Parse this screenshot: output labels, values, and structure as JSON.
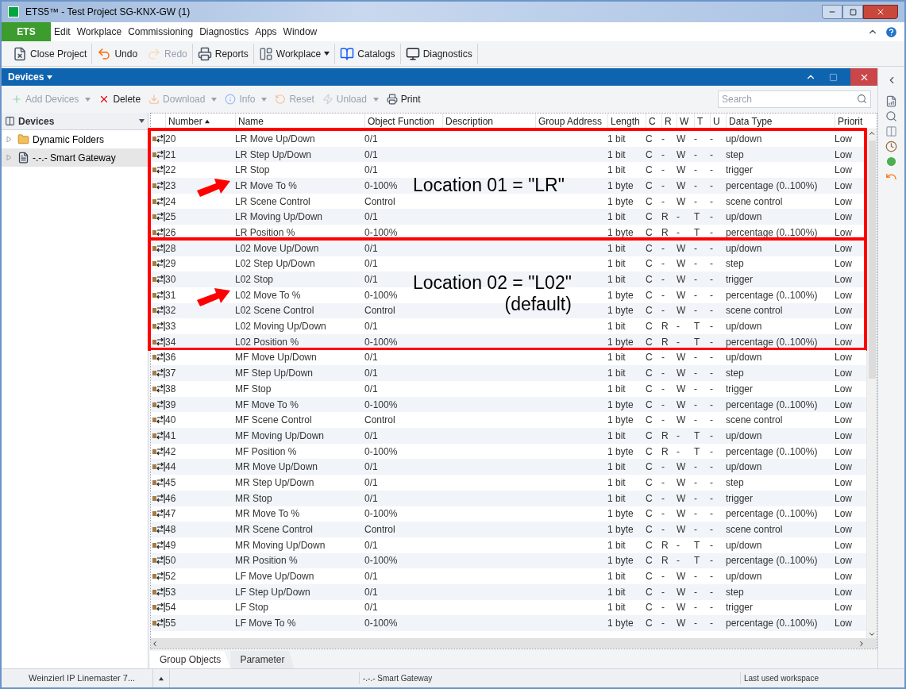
{
  "window": {
    "title": "ETS5™ - Test Project SG-KNX-GW (1)"
  },
  "menu": {
    "app_tab": "ETS",
    "items": [
      "Edit",
      "Workplace",
      "Commissioning",
      "Diagnostics",
      "Apps",
      "Window"
    ]
  },
  "toolbar": [
    {
      "label": "Close Project",
      "kind": "close",
      "disabled": false,
      "dropdown": false
    },
    {
      "label": "Undo",
      "kind": "undo",
      "disabled": false,
      "dropdown": false
    },
    {
      "label": "Redo",
      "kind": "redo",
      "disabled": true,
      "dropdown": false
    },
    {
      "label": "Reports",
      "kind": "print",
      "disabled": false,
      "dropdown": false
    },
    {
      "label": "Workplace",
      "kind": "layout",
      "disabled": false,
      "dropdown": true
    },
    {
      "label": "Catalogs",
      "kind": "book",
      "disabled": false,
      "dropdown": false
    },
    {
      "label": "Diagnostics",
      "kind": "monitor",
      "disabled": false,
      "dropdown": false
    }
  ],
  "panel": {
    "title": "Devices",
    "actions": [
      {
        "label": "Add Devices",
        "kind": "add",
        "disabled": true,
        "dropdown": true
      },
      {
        "label": "Delete",
        "kind": "delete",
        "disabled": false,
        "dropdown": false
      },
      {
        "label": "Download",
        "kind": "download",
        "disabled": true,
        "dropdown": true
      },
      {
        "label": "Info",
        "kind": "info",
        "disabled": true,
        "dropdown": true
      },
      {
        "label": "Reset",
        "kind": "reset",
        "disabled": true,
        "dropdown": false
      },
      {
        "label": "Unload",
        "kind": "unload",
        "disabled": true,
        "dropdown": true
      },
      {
        "label": "Print",
        "kind": "print",
        "disabled": false,
        "dropdown": false
      }
    ],
    "search": {
      "placeholder": "Search"
    }
  },
  "sidebar": {
    "title": "Devices",
    "items": [
      {
        "label": "Dynamic Folders",
        "kind": "folder",
        "expanded": false,
        "selected": false
      },
      {
        "label": "-.-.- Smart Gateway",
        "kind": "device",
        "expanded": false,
        "selected": true
      }
    ]
  },
  "table": {
    "columns": [
      {
        "label": "Number",
        "sorted": true
      },
      {
        "label": "Name",
        "sorted": false
      },
      {
        "label": "Object Function",
        "sorted": false
      },
      {
        "label": "Description",
        "sorted": false
      },
      {
        "label": "Group Address",
        "sorted": false
      },
      {
        "label": "Length",
        "sorted": false
      },
      {
        "label": "C",
        "sorted": false
      },
      {
        "label": "R",
        "sorted": false
      },
      {
        "label": "W",
        "sorted": false
      },
      {
        "label": "T",
        "sorted": false
      },
      {
        "label": "U",
        "sorted": false
      },
      {
        "label": "Data Type",
        "sorted": false
      },
      {
        "label": "Priorit",
        "sorted": false
      }
    ],
    "row_groups": [
      {
        "callout": [
          "Location 01 = \"LR\""
        ],
        "rows": [
          {
            "number": "20",
            "name": "LR Move Up/Down",
            "function": "0/1",
            "length": "1 bit",
            "flags": [
              "C",
              "-",
              "W",
              "-",
              "-"
            ],
            "data_type": "up/down",
            "priority": "Low"
          },
          {
            "number": "21",
            "name": "LR Step Up/Down",
            "function": "0/1",
            "length": "1 bit",
            "flags": [
              "C",
              "-",
              "W",
              "-",
              "-"
            ],
            "data_type": "step",
            "priority": "Low"
          },
          {
            "number": "22",
            "name": "LR Stop",
            "function": "0/1",
            "length": "1 bit",
            "flags": [
              "C",
              "-",
              "W",
              "-",
              "-"
            ],
            "data_type": "trigger",
            "priority": "Low"
          },
          {
            "number": "23",
            "name": "LR Move To %",
            "function": "0-100%",
            "length": "1 byte",
            "flags": [
              "C",
              "-",
              "W",
              "-",
              "-"
            ],
            "data_type": "percentage (0..100%)",
            "priority": "Low"
          },
          {
            "number": "24",
            "name": "LR Scene Control",
            "function": "Control",
            "length": "1 byte",
            "flags": [
              "C",
              "-",
              "W",
              "-",
              "-"
            ],
            "data_type": "scene control",
            "priority": "Low"
          },
          {
            "number": "25",
            "name": "LR Moving Up/Down",
            "function": "0/1",
            "length": "1 bit",
            "flags": [
              "C",
              "R",
              "-",
              "T",
              "-"
            ],
            "data_type": "up/down",
            "priority": "Low"
          },
          {
            "number": "26",
            "name": "LR Position %",
            "function": "0-100%",
            "length": "1 byte",
            "flags": [
              "C",
              "R",
              "-",
              "T",
              "-"
            ],
            "data_type": "percentage (0..100%)",
            "priority": "Low"
          }
        ]
      },
      {
        "callout": [
          "Location 02 = \"L02\"",
          "(default)"
        ],
        "rows": [
          {
            "number": "28",
            "name": "L02 Move Up/Down",
            "function": "0/1",
            "length": "1 bit",
            "flags": [
              "C",
              "-",
              "W",
              "-",
              "-"
            ],
            "data_type": "up/down",
            "priority": "Low"
          },
          {
            "number": "29",
            "name": "L02 Step Up/Down",
            "function": "0/1",
            "length": "1 bit",
            "flags": [
              "C",
              "-",
              "W",
              "-",
              "-"
            ],
            "data_type": "step",
            "priority": "Low"
          },
          {
            "number": "30",
            "name": "L02 Stop",
            "function": "0/1",
            "length": "1 bit",
            "flags": [
              "C",
              "-",
              "W",
              "-",
              "-"
            ],
            "data_type": "trigger",
            "priority": "Low"
          },
          {
            "number": "31",
            "name": "L02 Move To %",
            "function": "0-100%",
            "length": "1 byte",
            "flags": [
              "C",
              "-",
              "W",
              "-",
              "-"
            ],
            "data_type": "percentage (0..100%)",
            "priority": "Low"
          },
          {
            "number": "32",
            "name": "L02 Scene Control",
            "function": "Control",
            "length": "1 byte",
            "flags": [
              "C",
              "-",
              "W",
              "-",
              "-"
            ],
            "data_type": "scene control",
            "priority": "Low"
          },
          {
            "number": "33",
            "name": "L02 Moving Up/Down",
            "function": "0/1",
            "length": "1 bit",
            "flags": [
              "C",
              "R",
              "-",
              "T",
              "-"
            ],
            "data_type": "up/down",
            "priority": "Low"
          },
          {
            "number": "34",
            "name": "L02 Position %",
            "function": "0-100%",
            "length": "1 byte",
            "flags": [
              "C",
              "R",
              "-",
              "T",
              "-"
            ],
            "data_type": "percentage (0..100%)",
            "priority": "Low"
          }
        ]
      },
      {
        "rows": [
          {
            "number": "36",
            "name": "MF Move Up/Down",
            "function": "0/1",
            "length": "1 bit",
            "flags": [
              "C",
              "-",
              "W",
              "-",
              "-"
            ],
            "data_type": "up/down",
            "priority": "Low"
          },
          {
            "number": "37",
            "name": "MF Step Up/Down",
            "function": "0/1",
            "length": "1 bit",
            "flags": [
              "C",
              "-",
              "W",
              "-",
              "-"
            ],
            "data_type": "step",
            "priority": "Low"
          },
          {
            "number": "38",
            "name": "MF Stop",
            "function": "0/1",
            "length": "1 bit",
            "flags": [
              "C",
              "-",
              "W",
              "-",
              "-"
            ],
            "data_type": "trigger",
            "priority": "Low"
          },
          {
            "number": "39",
            "name": "MF Move To %",
            "function": "0-100%",
            "length": "1 byte",
            "flags": [
              "C",
              "-",
              "W",
              "-",
              "-"
            ],
            "data_type": "percentage (0..100%)",
            "priority": "Low"
          },
          {
            "number": "40",
            "name": "MF Scene Control",
            "function": "Control",
            "length": "1 byte",
            "flags": [
              "C",
              "-",
              "W",
              "-",
              "-"
            ],
            "data_type": "scene control",
            "priority": "Low"
          },
          {
            "number": "41",
            "name": "MF Moving Up/Down",
            "function": "0/1",
            "length": "1 bit",
            "flags": [
              "C",
              "R",
              "-",
              "T",
              "-"
            ],
            "data_type": "up/down",
            "priority": "Low"
          },
          {
            "number": "42",
            "name": "MF Position %",
            "function": "0-100%",
            "length": "1 byte",
            "flags": [
              "C",
              "R",
              "-",
              "T",
              "-"
            ],
            "data_type": "percentage (0..100%)",
            "priority": "Low"
          },
          {
            "number": "44",
            "name": "MR Move Up/Down",
            "function": "0/1",
            "length": "1 bit",
            "flags": [
              "C",
              "-",
              "W",
              "-",
              "-"
            ],
            "data_type": "up/down",
            "priority": "Low"
          },
          {
            "number": "45",
            "name": "MR Step Up/Down",
            "function": "0/1",
            "length": "1 bit",
            "flags": [
              "C",
              "-",
              "W",
              "-",
              "-"
            ],
            "data_type": "step",
            "priority": "Low"
          },
          {
            "number": "46",
            "name": "MR Stop",
            "function": "0/1",
            "length": "1 bit",
            "flags": [
              "C",
              "-",
              "W",
              "-",
              "-"
            ],
            "data_type": "trigger",
            "priority": "Low"
          },
          {
            "number": "47",
            "name": "MR Move To %",
            "function": "0-100%",
            "length": "1 byte",
            "flags": [
              "C",
              "-",
              "W",
              "-",
              "-"
            ],
            "data_type": "percentage (0..100%)",
            "priority": "Low"
          },
          {
            "number": "48",
            "name": "MR Scene Control",
            "function": "Control",
            "length": "1 byte",
            "flags": [
              "C",
              "-",
              "W",
              "-",
              "-"
            ],
            "data_type": "scene control",
            "priority": "Low"
          },
          {
            "number": "49",
            "name": "MR Moving Up/Down",
            "function": "0/1",
            "length": "1 bit",
            "flags": [
              "C",
              "R",
              "-",
              "T",
              "-"
            ],
            "data_type": "up/down",
            "priority": "Low"
          },
          {
            "number": "50",
            "name": "MR Position %",
            "function": "0-100%",
            "length": "1 byte",
            "flags": [
              "C",
              "R",
              "-",
              "T",
              "-"
            ],
            "data_type": "percentage (0..100%)",
            "priority": "Low"
          },
          {
            "number": "52",
            "name": "LF Move Up/Down",
            "function": "0/1",
            "length": "1 bit",
            "flags": [
              "C",
              "-",
              "W",
              "-",
              "-"
            ],
            "data_type": "up/down",
            "priority": "Low"
          },
          {
            "number": "53",
            "name": "LF Step Up/Down",
            "function": "0/1",
            "length": "1 bit",
            "flags": [
              "C",
              "-",
              "W",
              "-",
              "-"
            ],
            "data_type": "step",
            "priority": "Low"
          },
          {
            "number": "54",
            "name": "LF Stop",
            "function": "0/1",
            "length": "1 bit",
            "flags": [
              "C",
              "-",
              "W",
              "-",
              "-"
            ],
            "data_type": "trigger",
            "priority": "Low"
          },
          {
            "number": "55",
            "name": "LF Move To %",
            "function": "0-100%",
            "length": "1 byte",
            "flags": [
              "C",
              "-",
              "W",
              "-",
              "-"
            ],
            "data_type": "percentage (0..100%)",
            "priority": "Low"
          }
        ]
      }
    ]
  },
  "tabs": [
    {
      "label": "Group Objects",
      "selected": true
    },
    {
      "label": "Parameter",
      "selected": false
    }
  ],
  "status_bar": {
    "device": "Weinzierl IP Linemaster 7...",
    "selection": "-.-.- Smart Gateway",
    "workspace": "Last used workspace"
  }
}
